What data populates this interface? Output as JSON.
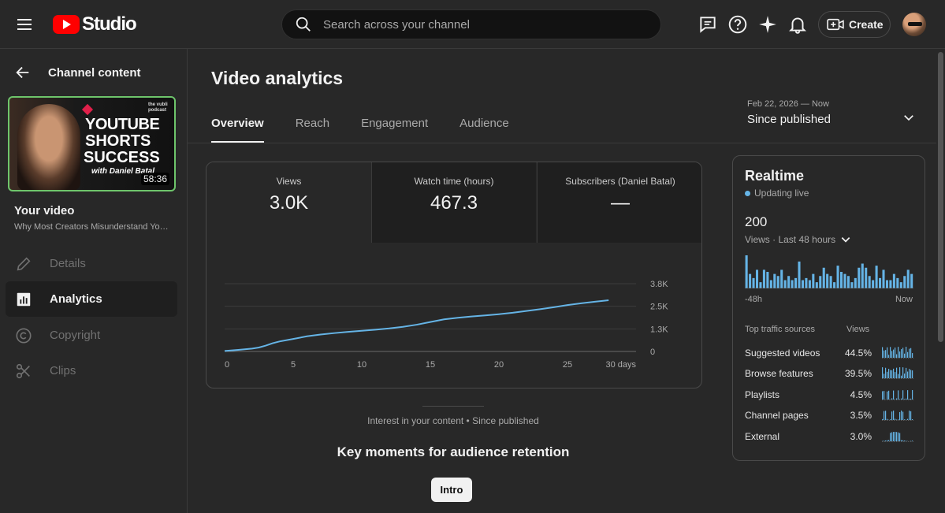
{
  "header": {
    "logo_text": "Studio",
    "search_placeholder": "Search across your channel",
    "create_label": "Create"
  },
  "sidebar": {
    "back_label": "Channel content",
    "thumbnail": {
      "podcast_text": "the vubli podcast",
      "line1": "YOUTUBE",
      "line2": "SHORTS",
      "line3": "SUCCESS",
      "line4": "with Daniel Batal",
      "duration": "58:36"
    },
    "your_video_label": "Your video",
    "video_title": "Why Most Creators Misunderstand YouTube Shorts",
    "nav": [
      {
        "label": "Details",
        "icon": "pencil-icon"
      },
      {
        "label": "Analytics",
        "icon": "analytics-icon"
      },
      {
        "label": "Copyright",
        "icon": "copyright-icon"
      },
      {
        "label": "Clips",
        "icon": "scissors-icon"
      }
    ]
  },
  "main": {
    "title": "Video analytics",
    "tabs": [
      "Overview",
      "Reach",
      "Engagement",
      "Audience"
    ],
    "date_range": "Feb 22, 2026 — Now",
    "date_label": "Since published",
    "metrics": [
      {
        "label": "Views",
        "value": "3.0K"
      },
      {
        "label": "Watch time (hours)",
        "value": "467.3"
      },
      {
        "label": "Subscribers (Daniel Batal)",
        "value": "—"
      }
    ],
    "interest_text": "Interest in your content • Since published",
    "key_moments_title": "Key moments for audience retention",
    "intro_label": "Intro"
  },
  "chart_data": {
    "type": "line",
    "x_ticks": [
      "0",
      "5",
      "10",
      "15",
      "20",
      "25",
      "30 days"
    ],
    "y_ticks": [
      "0",
      "1.3K",
      "2.5K",
      "3.8K"
    ],
    "xlim": [
      0,
      30
    ],
    "ylim": [
      0,
      3800
    ],
    "series": [
      {
        "x": [
          0,
          1,
          2,
          2.5,
          3,
          3.5,
          4,
          5,
          6,
          7,
          8,
          9,
          10,
          11,
          12,
          13,
          14,
          15,
          16,
          17,
          18,
          19,
          20,
          21,
          22,
          23,
          24,
          25,
          26,
          27,
          28
        ],
        "values": [
          30,
          90,
          160,
          220,
          330,
          460,
          560,
          700,
          850,
          950,
          1030,
          1100,
          1160,
          1220,
          1290,
          1380,
          1500,
          1650,
          1800,
          1890,
          1960,
          2020,
          2090,
          2170,
          2270,
          2370,
          2480,
          2600,
          2700,
          2790,
          2870
        ],
        "color": "#65b4e6"
      }
    ],
    "grid": true
  },
  "realtime": {
    "title": "Realtime",
    "status": "Updating live",
    "count": "200",
    "period": "Views · Last 48 hours",
    "axis_left": "-48h",
    "axis_right": "Now",
    "bars": [
      16,
      7,
      5,
      9,
      3,
      9,
      8,
      4,
      7,
      6,
      9,
      4,
      6,
      4,
      5,
      13,
      4,
      5,
      4,
      7,
      3,
      6,
      10,
      7,
      6,
      3,
      11,
      8,
      7,
      6,
      3,
      5,
      10,
      12,
      10,
      6,
      4,
      11,
      5,
      9,
      4,
      4,
      7,
      5,
      3,
      6,
      9,
      7
    ],
    "traffic_header": "Top traffic sources",
    "traffic_views_header": "Views",
    "sources": [
      {
        "name": "Suggested videos",
        "pct": "44.5%"
      },
      {
        "name": "Browse features",
        "pct": "39.5%"
      },
      {
        "name": "Playlists",
        "pct": "4.5%"
      },
      {
        "name": "Channel pages",
        "pct": "3.5%"
      },
      {
        "name": "External",
        "pct": "3.0%"
      }
    ],
    "bar_color": "#65b4e6"
  }
}
